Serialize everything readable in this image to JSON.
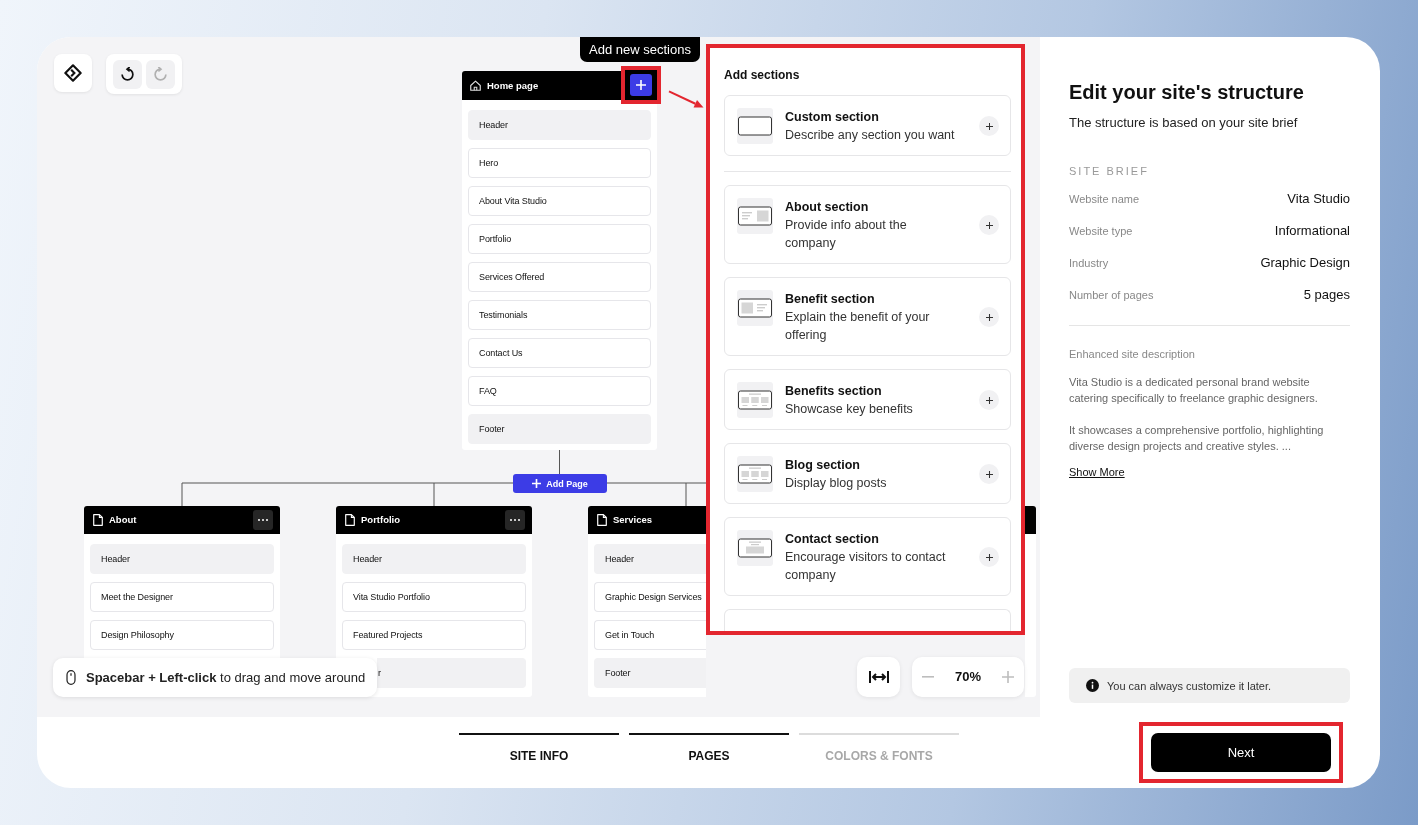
{
  "toolbar": {
    "undo": {
      "disabled": false
    },
    "redo": {
      "disabled": true
    }
  },
  "tooltip": "Add new sections",
  "home_page": {
    "title": "Home page",
    "add_button_highlighted": true,
    "sections": [
      {
        "label": "Header",
        "kind": "global"
      },
      {
        "label": "Hero",
        "kind": "page"
      },
      {
        "label": "About Vita Studio",
        "kind": "page"
      },
      {
        "label": "Portfolio",
        "kind": "page"
      },
      {
        "label": "Services Offered",
        "kind": "page"
      },
      {
        "label": "Testimonials",
        "kind": "page"
      },
      {
        "label": "Contact Us",
        "kind": "page"
      },
      {
        "label": "FAQ",
        "kind": "page"
      },
      {
        "label": "Footer",
        "kind": "global"
      }
    ]
  },
  "add_page_button": "Add Page",
  "pages": [
    {
      "title": "About",
      "menu": true,
      "sections": [
        {
          "label": "Header",
          "kind": "global"
        },
        {
          "label": "Meet the Designer",
          "kind": "page"
        },
        {
          "label": "Design Philosophy",
          "kind": "page"
        }
      ]
    },
    {
      "title": "Portfolio",
      "menu": true,
      "sections": [
        {
          "label": "Header",
          "kind": "global"
        },
        {
          "label": "Vita Studio Portfolio",
          "kind": "page"
        },
        {
          "label": "Featured Projects",
          "kind": "page"
        },
        {
          "label": "r",
          "kind": "global",
          "covered": true
        }
      ]
    },
    {
      "title": "Services",
      "menu": false,
      "sections": [
        {
          "label": "Header",
          "kind": "global"
        },
        {
          "label": "Graphic Design Services",
          "kind": "page"
        },
        {
          "label": "Get in Touch",
          "kind": "page"
        },
        {
          "label": "Footer",
          "kind": "global"
        }
      ]
    }
  ],
  "partly_hidden_page": true,
  "hint": "**Spacebar + Left-click** to drag and move around",
  "zoom_level": "70%",
  "add_sections_panel": {
    "title": "Add sections",
    "highlighted": true,
    "groups": [
      [
        {
          "kind": "blank",
          "title": "Custom section",
          "description": "Describe any section you want"
        }
      ],
      [
        {
          "kind": "text-image",
          "title": "About section",
          "description": "Provide info about the company"
        },
        {
          "kind": "image-text",
          "title": "Benefit section",
          "description": "Explain the benefit of your offering"
        },
        {
          "kind": "three-column",
          "title": "Benefits section",
          "description": "Showcase key benefits"
        },
        {
          "kind": "three-column",
          "title": "Blog section",
          "description": "Display blog posts"
        },
        {
          "kind": "centered",
          "title": "Contact section",
          "description": "Encourage visitors to contact company"
        }
      ]
    ],
    "more_below": true
  },
  "steps": [
    {
      "label": "SITE INFO",
      "active": true
    },
    {
      "label": "PAGES",
      "active": true
    },
    {
      "label": "COLORS & FONTS",
      "active": false
    }
  ],
  "site_panel": {
    "title": "Edit your site's structure",
    "subtitle": "The structure is based on your site brief",
    "brief_heading": "SITE BRIEF",
    "brief": [
      {
        "label": "Website name",
        "value": "Vita Studio"
      },
      {
        "label": "Website type",
        "value": "Informational"
      },
      {
        "label": "Industry",
        "value": "Graphic Design"
      },
      {
        "label": "Number of pages",
        "value": "5 pages"
      }
    ],
    "description_heading": "Enhanced site description",
    "description": [
      "Vita Studio is a dedicated personal brand website catering specifically to freelance graphic designers.",
      "It showcases a comprehensive portfolio, highlighting diverse design projects and creative styles. ..."
    ],
    "show_more": "Show More",
    "note": "You can always customize it later."
  },
  "next_button": {
    "label": "Next",
    "highlighted": true
  }
}
